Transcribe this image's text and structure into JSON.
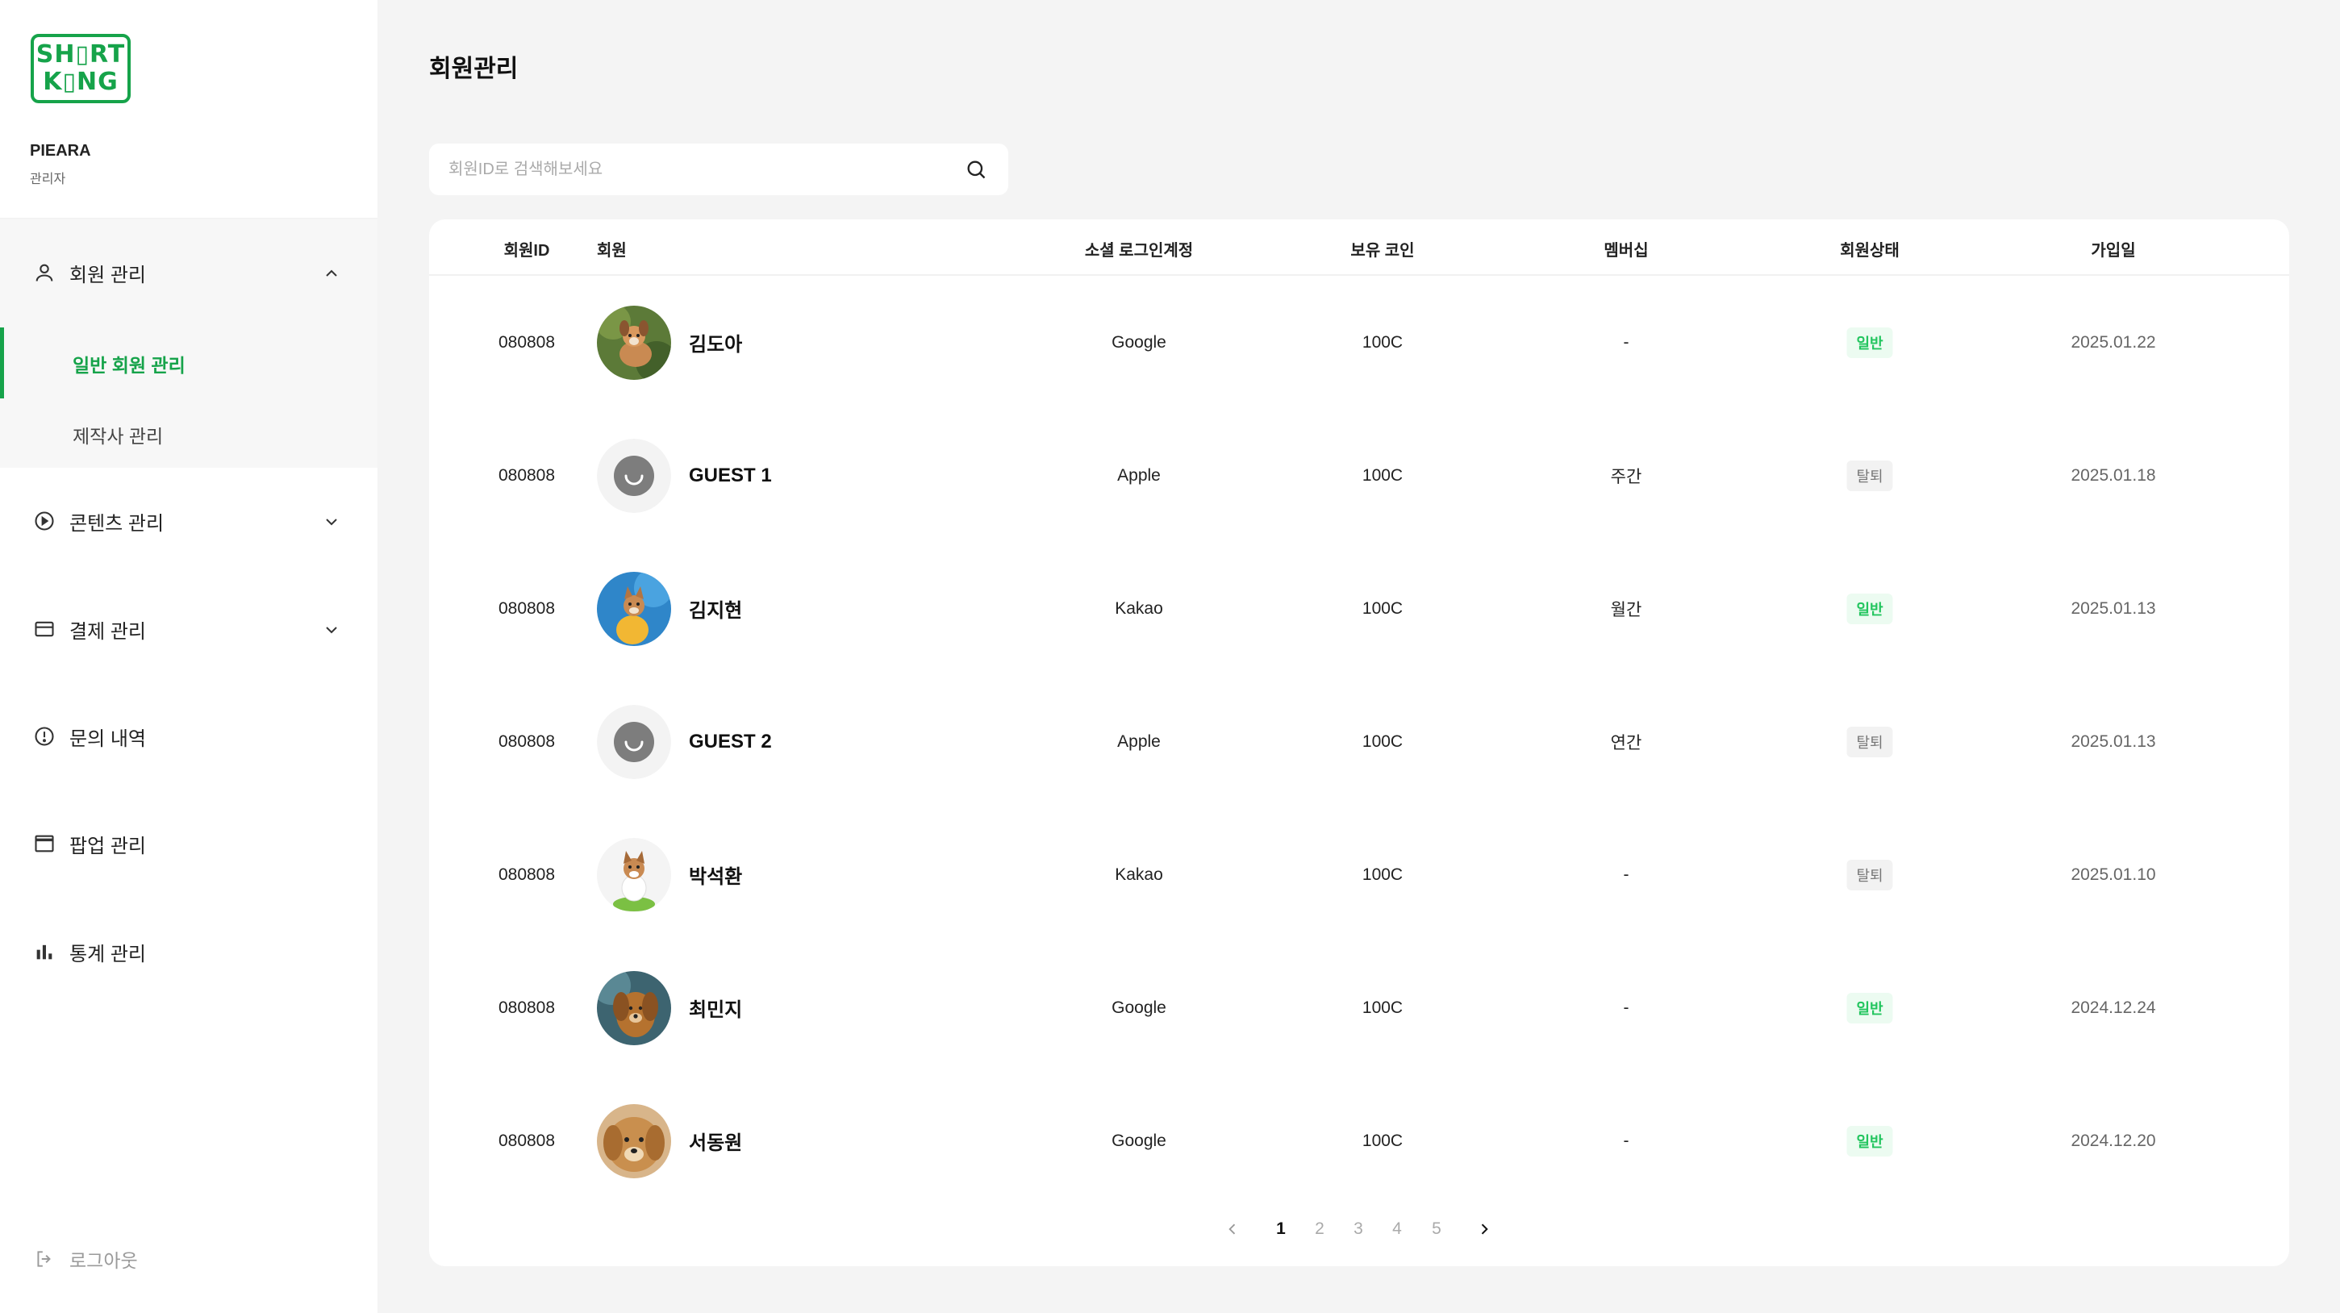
{
  "sidebar": {
    "logo_lines": [
      "SH▯RT",
      "K▯NG"
    ],
    "org_name": "PIEARA",
    "org_role": "관리자",
    "menu": {
      "members": "회원 관리",
      "members_sub": [
        "일반 회원 관리",
        "제작사 관리"
      ],
      "contents": "콘텐츠 관리",
      "payments": "결제 관리",
      "inquiries": "문의 내역",
      "popups": "팝업 관리",
      "stats": "통계 관리"
    },
    "logout": "로그아웃"
  },
  "page_title": "회원관리",
  "search": {
    "placeholder": "회원ID로 검색해보세요"
  },
  "table": {
    "headers": [
      "회원ID",
      "회원",
      "소셜 로그인계정",
      "보유 코인",
      "멤버십",
      "회원상태",
      "가입일"
    ],
    "rows": [
      {
        "id": "080808",
        "name": "김도아",
        "social": "Google",
        "coins": "100C",
        "membership": "-",
        "status": "일반",
        "joined": "2025.01.22"
      },
      {
        "id": "080808",
        "name": "GUEST 1",
        "social": "Apple",
        "coins": "100C",
        "membership": "주간",
        "status": "탈퇴",
        "joined": "2025.01.18"
      },
      {
        "id": "080808",
        "name": "김지현",
        "social": "Kakao",
        "coins": "100C",
        "membership": "월간",
        "status": "일반",
        "joined": "2025.01.13"
      },
      {
        "id": "080808",
        "name": "GUEST 2",
        "social": "Apple",
        "coins": "100C",
        "membership": "연간",
        "status": "탈퇴",
        "joined": "2025.01.13"
      },
      {
        "id": "080808",
        "name": "박석환",
        "social": "Kakao",
        "coins": "100C",
        "membership": "-",
        "status": "탈퇴",
        "joined": "2025.01.10"
      },
      {
        "id": "080808",
        "name": "최민지",
        "social": "Google",
        "coins": "100C",
        "membership": "-",
        "status": "일반",
        "joined": "2024.12.24"
      },
      {
        "id": "080808",
        "name": "서동원",
        "social": "Google",
        "coins": "100C",
        "membership": "-",
        "status": "일반",
        "joined": "2024.12.20"
      }
    ]
  },
  "pagination": {
    "pages": [
      "1",
      "2",
      "3",
      "4",
      "5"
    ],
    "current": "1"
  },
  "colors": {
    "accent": "#16a34a",
    "badge_normal_text": "#22c55e",
    "badge_normal_bg": "#ecfbf1"
  }
}
